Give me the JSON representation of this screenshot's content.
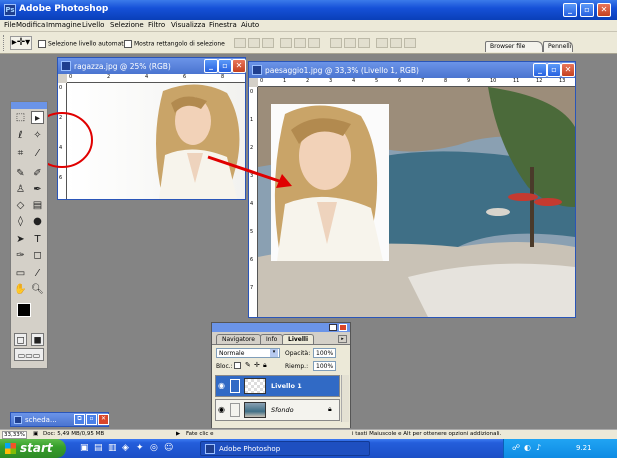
{
  "app": {
    "title": "Adobe Photoshop"
  },
  "menu": [
    "File",
    "Modifica",
    "Immagine",
    "Livello",
    "Selezione",
    "Filtro",
    "Visualizza",
    "Finestra",
    "Aiuto"
  ],
  "options": {
    "auto_select_label": "Selezione livello automatica",
    "show_bounds_label": "Mostra rettangolo di selezione",
    "browser_tab": "Browser file",
    "brushes_tab": "Pennelli"
  },
  "doc_ragazza": {
    "title": "ragazza.jpg @ 25% (RGB)",
    "ruler": [
      "0",
      "2",
      "4",
      "6",
      "8"
    ],
    "vruler": [
      "0",
      "2",
      "4",
      "6"
    ]
  },
  "doc_paesaggio": {
    "title": "paesaggio1.jpg @ 33,3% (Livello 1, RGB)",
    "ruler": [
      "0",
      "1",
      "2",
      "3",
      "4",
      "5",
      "6",
      "7",
      "8",
      "9",
      "10",
      "11",
      "12",
      "13"
    ],
    "vruler": [
      "0",
      "1",
      "2",
      "3",
      "4",
      "5",
      "6",
      "7"
    ]
  },
  "doc_scheda": {
    "title": "scheda..."
  },
  "layers": {
    "tabs": [
      "Navigatore",
      "Info",
      "Livelli"
    ],
    "blend_mode": "Normale",
    "opacity_label": "Opacità:",
    "opacity_value": "100%",
    "lock_label": "Bloc.:",
    "fill_label": "Riemp.:",
    "fill_value": "100%",
    "rows": [
      {
        "name": "Livello 1",
        "selected": true
      },
      {
        "name": "Sfondo",
        "selected": false
      }
    ]
  },
  "status": {
    "zoom": "33,33%",
    "doc": "Doc: 5,49 MB/0,95 MB",
    "hint_left": "Fate clic e",
    "hint_right": "i tasti Maiuscole e Alt per ottenere opzioni addizionali."
  },
  "taskbar": {
    "start": "start",
    "task": "Adobe Photoshop",
    "lang": "IT",
    "clock": "9.21"
  },
  "colors": {
    "title_blue": "#1651d8",
    "selected_layer": "#316ac5",
    "annotation_red": "#e00000"
  }
}
